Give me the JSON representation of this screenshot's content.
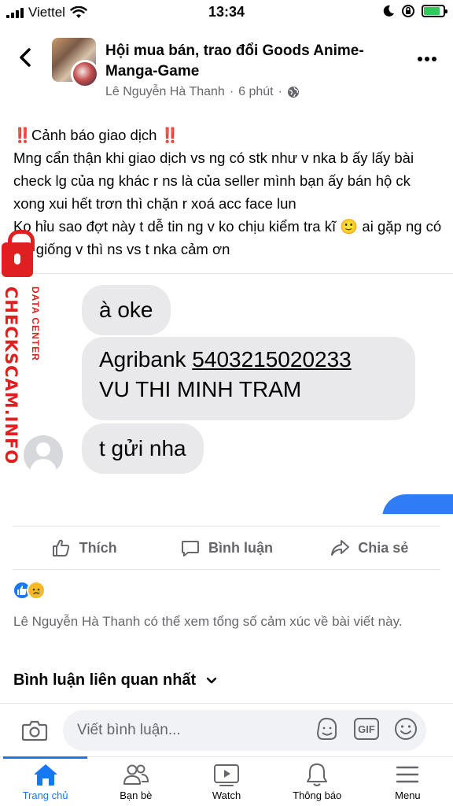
{
  "status_bar": {
    "carrier": "Viettel",
    "time": "13:34",
    "battery_level": 0.85,
    "battery_color": "#34c759"
  },
  "header": {
    "back_icon": "chevron-left-icon",
    "group_name": "Hội mua bán, trao đổi Goods Anime-Manga-Game",
    "author": "Lê Nguyễn Hà Thanh",
    "time_ago": "6 phút",
    "privacy_icon": "globe-icon",
    "more_icon": "more-horizontal-icon"
  },
  "post": {
    "warning_prefix": "‼️",
    "title": "Cảnh báo giao dịch",
    "warning_suffix": "‼️",
    "paragraph_1": "Mng cẩn thận khi giao dịch vs ng có stk như v nka b ấy lấy bài check lg của ng khác r ns là của seller mình bạn ấy bán hộ ck xong xui hết trơn thì chặn r xoá acc face lun",
    "paragraph_2": "Ko hỉu sao đợt này t dễ tin ng v ko chịu kiểm tra kĩ 🙂 ai gặp ng có stk giống v thì ns vs t nka cảm ơn"
  },
  "chat_image": {
    "bubble_1": "à oke",
    "bubble_2_bank": "Agribank",
    "bubble_2_account": "5403215020233",
    "bubble_2_name": "VU THI MINH TRAM",
    "bubble_3": "t gửi nha",
    "watermark_main": "CHECKSCAM.INFO",
    "watermark_sub": "DATA CENTER",
    "watermark_color": "#e02020"
  },
  "actions": {
    "like": "Thích",
    "comment": "Bình luận",
    "share": "Chia sẻ"
  },
  "reactions": {
    "like_icon": "like-reaction-icon",
    "sad_icon": "sad-reaction-icon",
    "visibility_note": "Lê Nguyễn Hà Thanh có thể xem tổng số cảm xúc về bài viết này."
  },
  "comments": {
    "sort_label": "Bình luận liên quan nhất",
    "input_placeholder": "Viết bình luận..."
  },
  "tab_bar": {
    "tabs": [
      {
        "label": "Trang chủ",
        "icon": "home-icon",
        "active": true
      },
      {
        "label": "Bạn bè",
        "icon": "friends-icon",
        "active": false
      },
      {
        "label": "Watch",
        "icon": "watch-icon",
        "active": false
      },
      {
        "label": "Thông báo",
        "icon": "bell-icon",
        "active": false
      },
      {
        "label": "Menu",
        "icon": "menu-icon",
        "active": false
      }
    ]
  },
  "colors": {
    "accent": "#1877f2",
    "secondary_text": "#65676b",
    "warning": "#e41e3f"
  }
}
